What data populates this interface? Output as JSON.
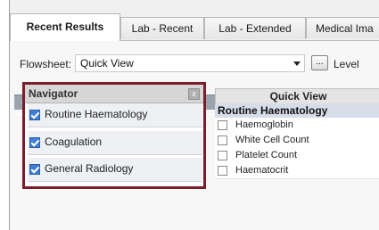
{
  "tabs": [
    {
      "label": "Recent Results",
      "active": true
    },
    {
      "label": "Lab - Recent",
      "active": false
    },
    {
      "label": "Lab - Extended",
      "active": false
    },
    {
      "label": "Medical Ima",
      "active": false
    }
  ],
  "flowsheet": {
    "label": "Flowsheet:",
    "selected": "Quick View",
    "more_button": "...",
    "level_label": "Level"
  },
  "navigator": {
    "title": "Navigator",
    "close_glyph": "x",
    "items": [
      {
        "label": "Routine Haematology",
        "checked": true
      },
      {
        "label": "Coagulation",
        "checked": true
      },
      {
        "label": "General Radiology",
        "checked": true
      }
    ]
  },
  "quick_view": {
    "header": "Quick View",
    "group": "Routine Haematology",
    "rows": [
      "Haemoglobin",
      "White Cell Count",
      "Platelet Count",
      "Haematocrit"
    ]
  },
  "colors": {
    "navigator_highlight": "#7b1d2a",
    "checkbox_checked": "#3f7fd3",
    "nav_bar": "#9aa5ad"
  }
}
